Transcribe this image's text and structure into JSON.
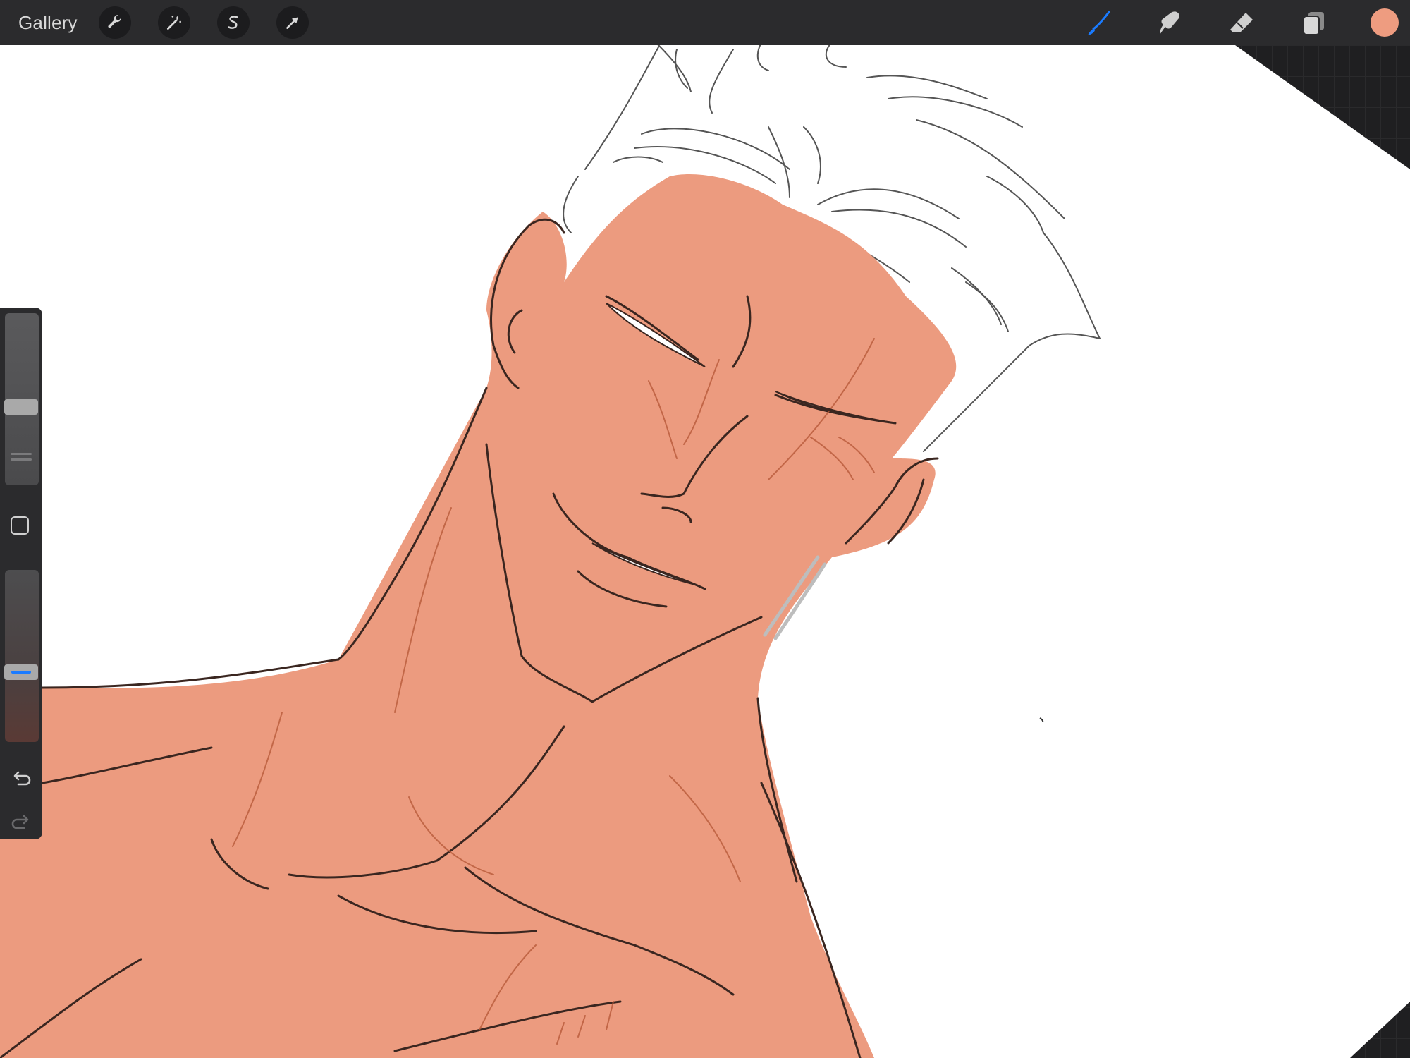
{
  "toolbar": {
    "gallery_label": "Gallery",
    "left_tools": [
      {
        "name": "actions",
        "icon": "wrench-icon"
      },
      {
        "name": "adjustments",
        "icon": "magic-wand-icon"
      },
      {
        "name": "selection",
        "icon": "selection-s-icon"
      },
      {
        "name": "transform",
        "icon": "arrow-cursor-icon"
      }
    ],
    "right_tools": [
      {
        "name": "brush",
        "icon": "brush-icon",
        "active": true
      },
      {
        "name": "smudge",
        "icon": "smudge-finger-icon",
        "active": false
      },
      {
        "name": "eraser",
        "icon": "eraser-icon",
        "active": false
      },
      {
        "name": "layers",
        "icon": "layers-icon",
        "active": false
      }
    ],
    "current_color": "#ee9c80"
  },
  "colors": {
    "toolbar_bg": "#2b2b2d",
    "accent_blue": "#1a7bff",
    "skin_fill": "#ec9b7f",
    "line_dark": "#3a2620",
    "line_warm": "#b85a3a"
  },
  "sidebar": {
    "brush_size_level": 0.5,
    "opacity_level": 0.45,
    "modify_icon": "square-modify-icon",
    "undo_icon": "undo-arrow-icon",
    "redo_icon": "redo-arrow-icon"
  }
}
